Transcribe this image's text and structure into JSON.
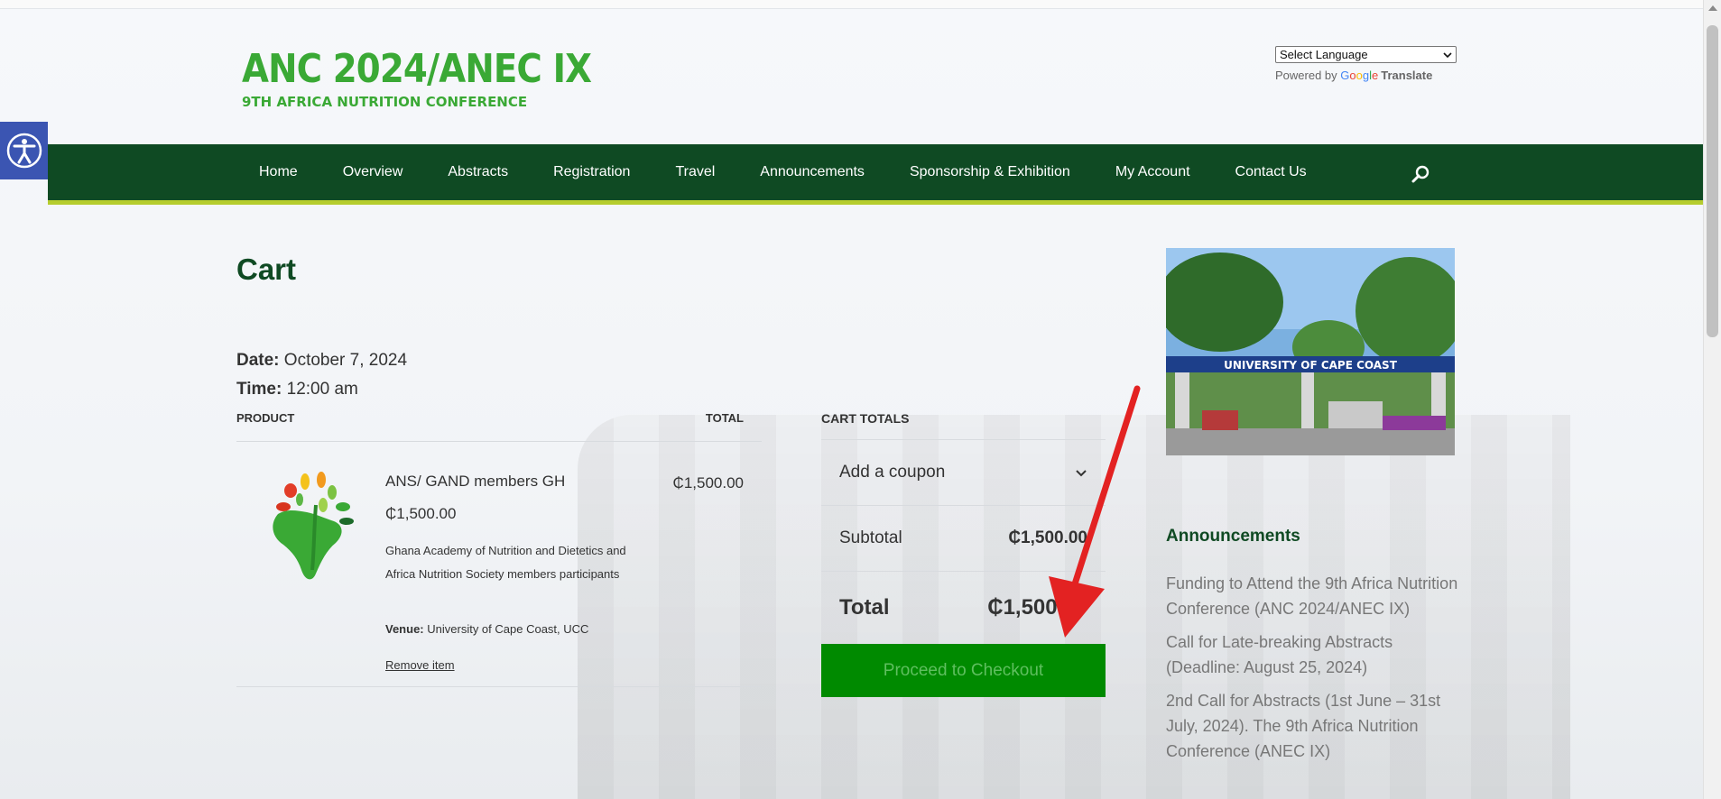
{
  "header": {
    "logo_title": "ANC 2024/ANEC IX",
    "logo_subtitle": "9TH AFRICA NUTRITION CONFERENCE",
    "language_select": "Select Language",
    "powered_by": "Powered by",
    "google": [
      "G",
      "o",
      "o",
      "g",
      "l",
      "e"
    ],
    "translate": "Translate"
  },
  "nav": {
    "items": [
      "Home",
      "Overview",
      "Abstracts",
      "Registration",
      "Travel",
      "Announcements",
      "Sponsorship & Exhibition",
      "My Account",
      "Contact Us"
    ]
  },
  "cart": {
    "title": "Cart",
    "date_label": "Date:",
    "date_value": "October 7, 2024",
    "time_label": "Time:",
    "time_value": "12:00 am",
    "col_product": "PRODUCT",
    "col_total": "TOTAL",
    "item": {
      "name": "ANS/ GAND members GH",
      "price": "₵1,500.00",
      "description": "Ghana Academy of Nutrition and Dietetics and Africa Nutrition Society members participants",
      "venue_label": "Venue:",
      "venue_value": "University of Cape Coast, UCC",
      "remove": "Remove item",
      "total": "₵1,500.00"
    }
  },
  "totals": {
    "heading": "CART TOTALS",
    "coupon": "Add a coupon",
    "subtotal_label": "Subtotal",
    "subtotal_value": "₵1,500.00",
    "total_label": "Total",
    "total_value": "₵1,500.00",
    "checkout": "Proceed to Checkout"
  },
  "sidebar": {
    "image_sign": "UNIVERSITY OF CAPE COAST",
    "announcements_title": "Announcements",
    "announcements": [
      "Funding to Attend the 9th Africa Nutrition Conference (ANC 2024/ANEC IX)",
      "Call for Late-breaking Abstracts (Deadline: August 25, 2024)",
      "2nd Call for Abstracts (1st June – 31st July, 2024). The 9th Africa Nutrition Conference (ANEC IX)"
    ]
  },
  "colors": {
    "nav_bg": "#0f4a23",
    "nav_border": "#b5cc2e",
    "brand_green": "#3aa935",
    "checkout_bg": "#008a00",
    "access_blue": "#3b55b2",
    "arrow_red": "#e32222"
  }
}
